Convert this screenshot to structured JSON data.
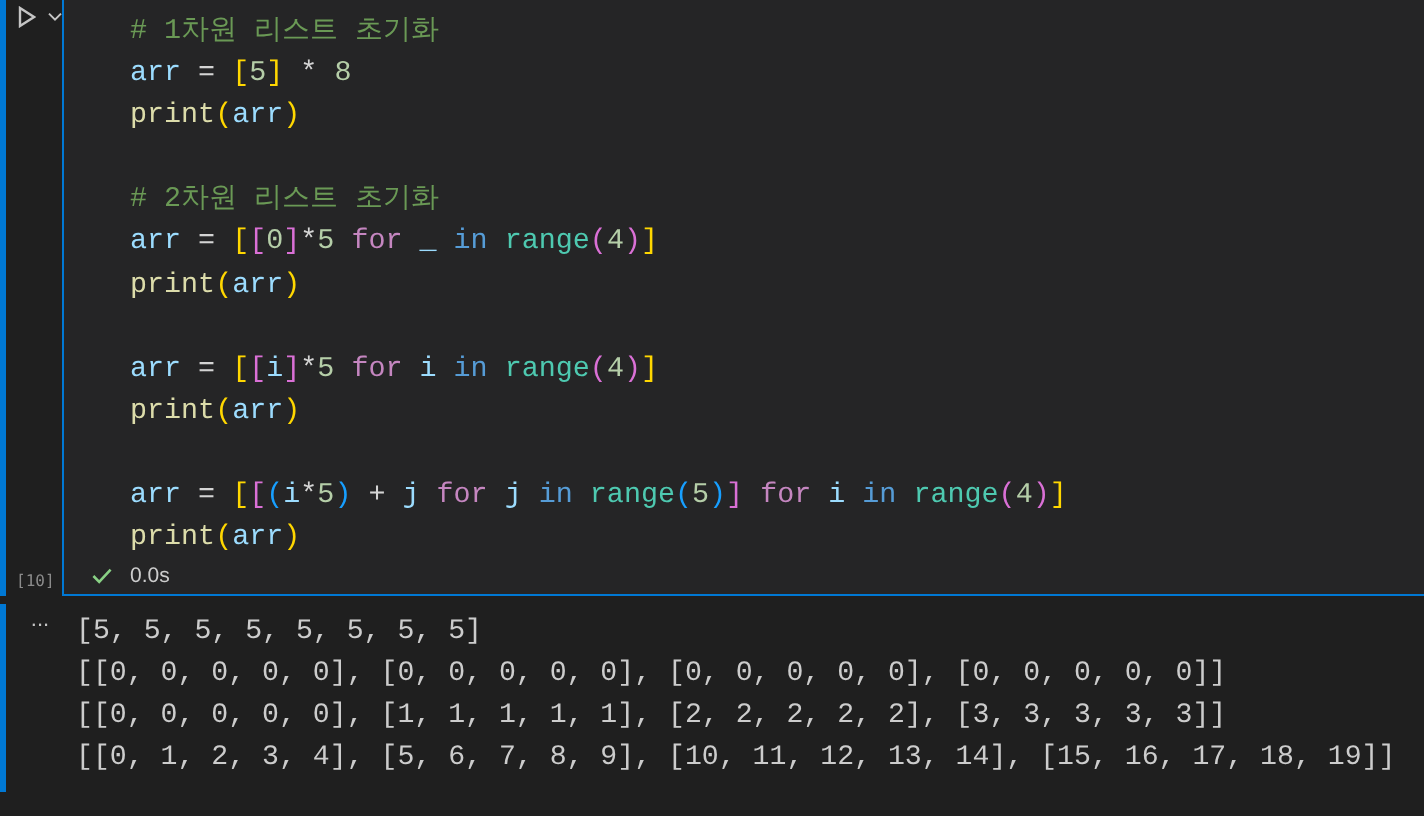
{
  "cell": {
    "execution_count": "[10]",
    "succeeded": true,
    "duration": "0.0s",
    "code_blocks": [
      [
        [
          {
            "kind": "comment",
            "text": "# 1차원 리스트 초기화"
          }
        ],
        [
          {
            "kind": "var",
            "text": "arr"
          },
          {
            "kind": "op",
            "text": " = "
          },
          {
            "kind": "br1",
            "text": "["
          },
          {
            "kind": "num",
            "text": "5"
          },
          {
            "kind": "br1",
            "text": "]"
          },
          {
            "kind": "op",
            "text": " * "
          },
          {
            "kind": "num",
            "text": "8"
          }
        ],
        [
          {
            "kind": "func",
            "text": "print"
          },
          {
            "kind": "br1",
            "text": "("
          },
          {
            "kind": "var",
            "text": "arr"
          },
          {
            "kind": "br1",
            "text": ")"
          }
        ]
      ],
      [
        [
          {
            "kind": "comment",
            "text": "# 2차원 리스트 초기화"
          }
        ],
        [
          {
            "kind": "var",
            "text": "arr"
          },
          {
            "kind": "op",
            "text": " = "
          },
          {
            "kind": "br1",
            "text": "["
          },
          {
            "kind": "br2",
            "text": "["
          },
          {
            "kind": "num",
            "text": "0"
          },
          {
            "kind": "br2",
            "text": "]"
          },
          {
            "kind": "op",
            "text": "*"
          },
          {
            "kind": "num",
            "text": "5 "
          },
          {
            "kind": "control",
            "text": "for "
          },
          {
            "kind": "var",
            "text": "_ "
          },
          {
            "kind": "keyword",
            "text": "in "
          },
          {
            "kind": "builtin",
            "text": "range"
          },
          {
            "kind": "br2",
            "text": "("
          },
          {
            "kind": "num",
            "text": "4"
          },
          {
            "kind": "br2",
            "text": ")"
          },
          {
            "kind": "br1",
            "text": "]"
          }
        ],
        [
          {
            "kind": "func",
            "text": "print"
          },
          {
            "kind": "br1",
            "text": "("
          },
          {
            "kind": "var",
            "text": "arr"
          },
          {
            "kind": "br1",
            "text": ")"
          }
        ]
      ],
      [
        [
          {
            "kind": "var",
            "text": "arr"
          },
          {
            "kind": "op",
            "text": " = "
          },
          {
            "kind": "br1",
            "text": "["
          },
          {
            "kind": "br2",
            "text": "["
          },
          {
            "kind": "var",
            "text": "i"
          },
          {
            "kind": "br2",
            "text": "]"
          },
          {
            "kind": "op",
            "text": "*"
          },
          {
            "kind": "num",
            "text": "5 "
          },
          {
            "kind": "control",
            "text": "for "
          },
          {
            "kind": "var",
            "text": "i "
          },
          {
            "kind": "keyword",
            "text": "in "
          },
          {
            "kind": "builtin",
            "text": "range"
          },
          {
            "kind": "br2",
            "text": "("
          },
          {
            "kind": "num",
            "text": "4"
          },
          {
            "kind": "br2",
            "text": ")"
          },
          {
            "kind": "br1",
            "text": "]"
          }
        ],
        [
          {
            "kind": "func",
            "text": "print"
          },
          {
            "kind": "br1",
            "text": "("
          },
          {
            "kind": "var",
            "text": "arr"
          },
          {
            "kind": "br1",
            "text": ")"
          }
        ]
      ],
      [
        [
          {
            "kind": "var",
            "text": "arr"
          },
          {
            "kind": "op",
            "text": " = "
          },
          {
            "kind": "br1",
            "text": "["
          },
          {
            "kind": "br2",
            "text": "["
          },
          {
            "kind": "br3",
            "text": "("
          },
          {
            "kind": "var",
            "text": "i"
          },
          {
            "kind": "op",
            "text": "*"
          },
          {
            "kind": "num",
            "text": "5"
          },
          {
            "kind": "br3",
            "text": ")"
          },
          {
            "kind": "op",
            "text": " + "
          },
          {
            "kind": "var",
            "text": "j "
          },
          {
            "kind": "control",
            "text": "for "
          },
          {
            "kind": "var",
            "text": "j "
          },
          {
            "kind": "keyword",
            "text": "in "
          },
          {
            "kind": "builtin",
            "text": "range"
          },
          {
            "kind": "br3",
            "text": "("
          },
          {
            "kind": "num",
            "text": "5"
          },
          {
            "kind": "br3",
            "text": ")"
          },
          {
            "kind": "br2",
            "text": "] "
          },
          {
            "kind": "control",
            "text": "for "
          },
          {
            "kind": "var",
            "text": "i "
          },
          {
            "kind": "keyword",
            "text": "in "
          },
          {
            "kind": "builtin",
            "text": "range"
          },
          {
            "kind": "br2",
            "text": "("
          },
          {
            "kind": "num",
            "text": "4"
          },
          {
            "kind": "br2",
            "text": ")"
          },
          {
            "kind": "br1",
            "text": "]"
          }
        ],
        [
          {
            "kind": "func",
            "text": "print"
          },
          {
            "kind": "br1",
            "text": "("
          },
          {
            "kind": "var",
            "text": "arr"
          },
          {
            "kind": "br1",
            "text": ")"
          }
        ]
      ]
    ],
    "output_menu": "...",
    "output_lines": [
      "[5, 5, 5, 5, 5, 5, 5, 5]",
      "[[0, 0, 0, 0, 0], [0, 0, 0, 0, 0], [0, 0, 0, 0, 0], [0, 0, 0, 0, 0]]",
      "[[0, 0, 0, 0, 0], [1, 1, 1, 1, 1], [2, 2, 2, 2, 2], [3, 3, 3, 3, 3]]",
      "[[0, 1, 2, 3, 4], [5, 6, 7, 8, 9], [10, 11, 12, 13, 14], [15, 16, 17, 18, 19]]"
    ]
  }
}
